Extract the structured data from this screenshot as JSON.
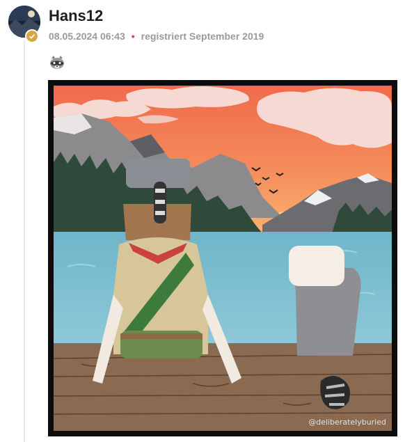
{
  "post": {
    "author": "Hans12",
    "timestamp": "08.05.2024 06:43",
    "separator": "•",
    "registered": "registriert September 2019",
    "content_icon": "raccoon-icon",
    "image_watermark": "@deliberatelyburied"
  },
  "colors": {
    "accent_dot": "#d83a6b",
    "badge": "#d9a441",
    "meta_text": "#9a9a9a"
  }
}
